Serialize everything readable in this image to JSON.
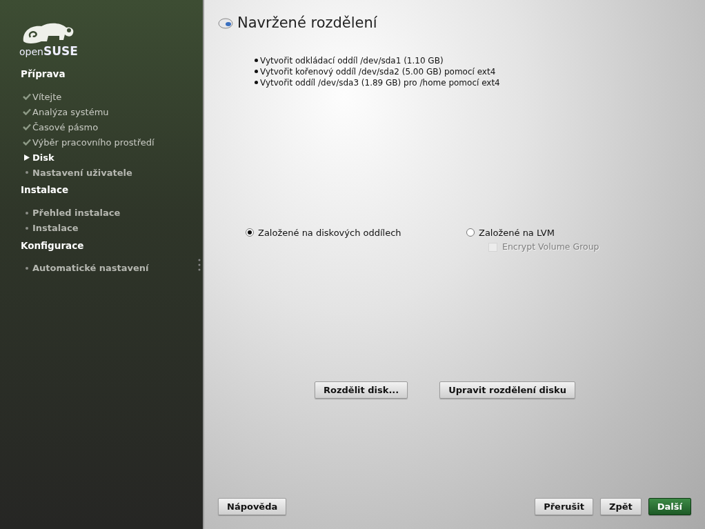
{
  "logo": {
    "text": "open**SUSE**"
  },
  "sidebar": {
    "sections": [
      {
        "title": "Příprava",
        "steps": [
          {
            "label": "Vítejte",
            "done": true,
            "selected": false
          },
          {
            "label": "Analýza systému",
            "done": true,
            "selected": false
          },
          {
            "label": "Časové pásmo",
            "done": true,
            "selected": false
          },
          {
            "label": "Výběr pracovního prostředí",
            "done": true,
            "selected": false
          },
          {
            "label": "Disk",
            "done": false,
            "selected": true
          },
          {
            "label": "Nastavení uživatele",
            "done": false,
            "selected": false
          }
        ]
      },
      {
        "title": "Instalace",
        "steps": [
          {
            "label": "Přehled instalace",
            "done": false,
            "selected": false
          },
          {
            "label": "Instalace",
            "done": false,
            "selected": false
          }
        ]
      },
      {
        "title": "Konfigurace",
        "steps": [
          {
            "label": "Automatické nastavení",
            "done": false,
            "selected": false
          }
        ]
      }
    ]
  },
  "page": {
    "title": "Navržené rozdělení",
    "proposal": [
      "Vytvořit odkládací oddíl /dev/sda1 (1.10 GB)",
      "Vytvořit kořenový oddíl /dev/sda2 (5.00 GB) pomocí ext4",
      "Vytvořit oddíl /dev/sda3 (1.89 GB) pro /home pomocí ext4"
    ],
    "options": [
      {
        "label": "Založené na diskových oddílech",
        "selected": true
      },
      {
        "label": "Založené na LVM",
        "selected": false
      }
    ],
    "encrypt": {
      "label": "Encrypt Volume Group",
      "checked": false,
      "disabled": true
    },
    "actions": [
      "Rozdělit disk...",
      "Upravit rozdělení disku"
    ]
  },
  "footer": {
    "help": "Nápověda",
    "buttons": [
      {
        "label": "Přerušit",
        "kind": "default"
      },
      {
        "label": "Zpět",
        "kind": "default"
      },
      {
        "label": "Další",
        "kind": "primary"
      }
    ]
  }
}
